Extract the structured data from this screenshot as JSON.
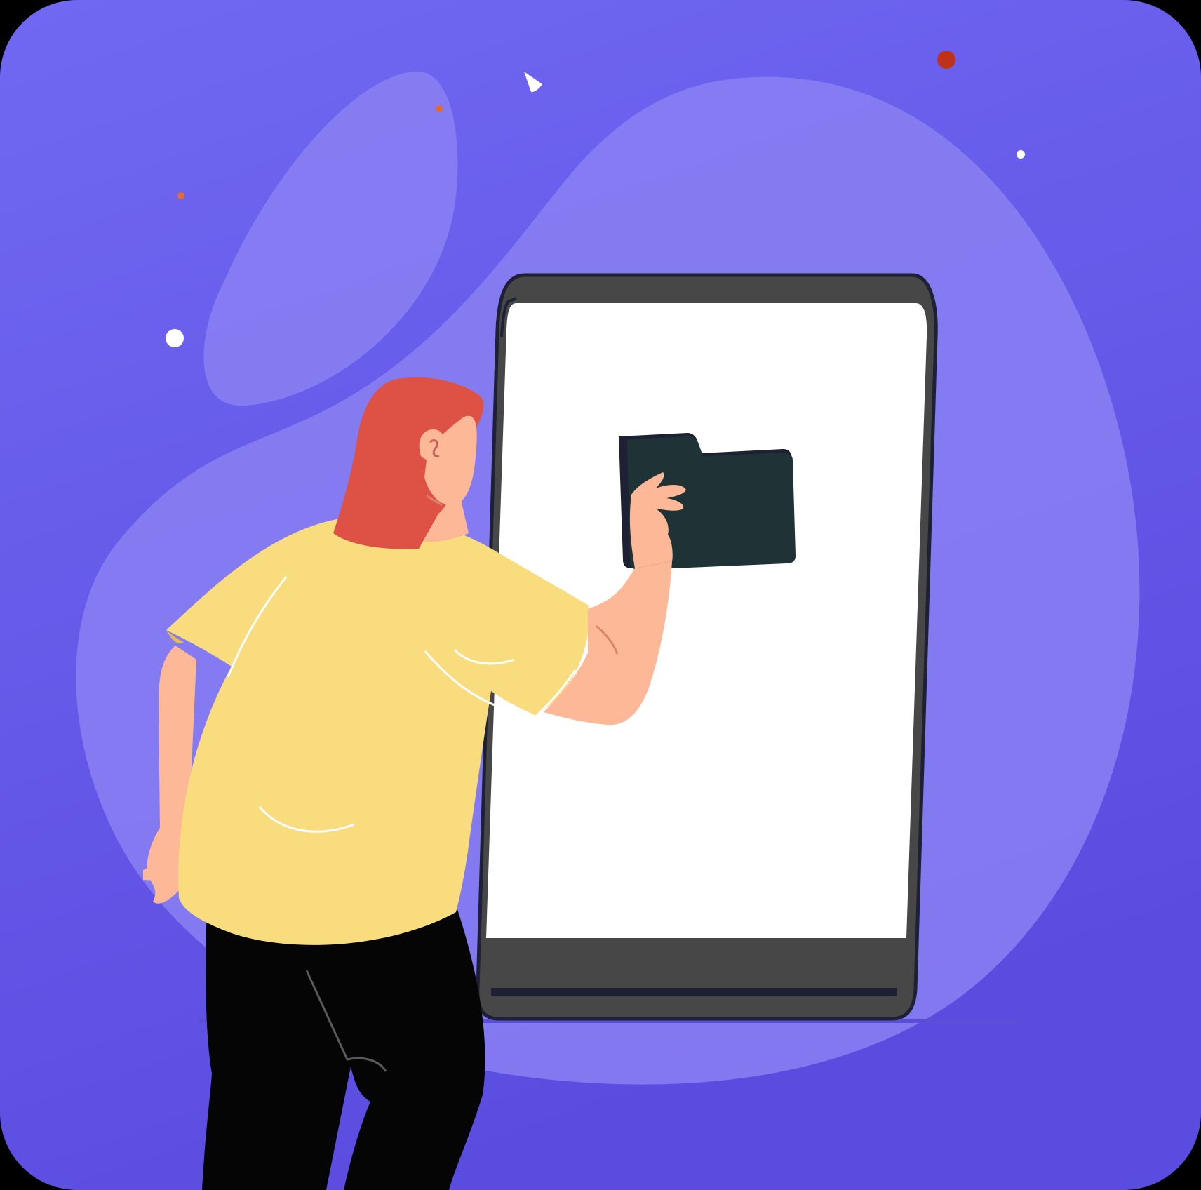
{
  "illustration": {
    "subject": "person-holding-folder-at-phone",
    "icons": [
      "folder-icon",
      "phone-device"
    ]
  },
  "colors": {
    "background_top": "#7068F2",
    "background_bottom": "#5B4CE0",
    "blob": "#8A80F2",
    "phone_frame": "#474747",
    "phone_outline": "#1E2033",
    "phone_screen": "#FFFFFF",
    "folder": "#1F3236",
    "hair": "#DE5246",
    "skin": "#FDB897",
    "shirt": "#F9DC7E",
    "pants": "#050505",
    "accent_orange": "#E8692C",
    "accent_red": "#C0311A",
    "sparkle": "#FFFFFF"
  }
}
